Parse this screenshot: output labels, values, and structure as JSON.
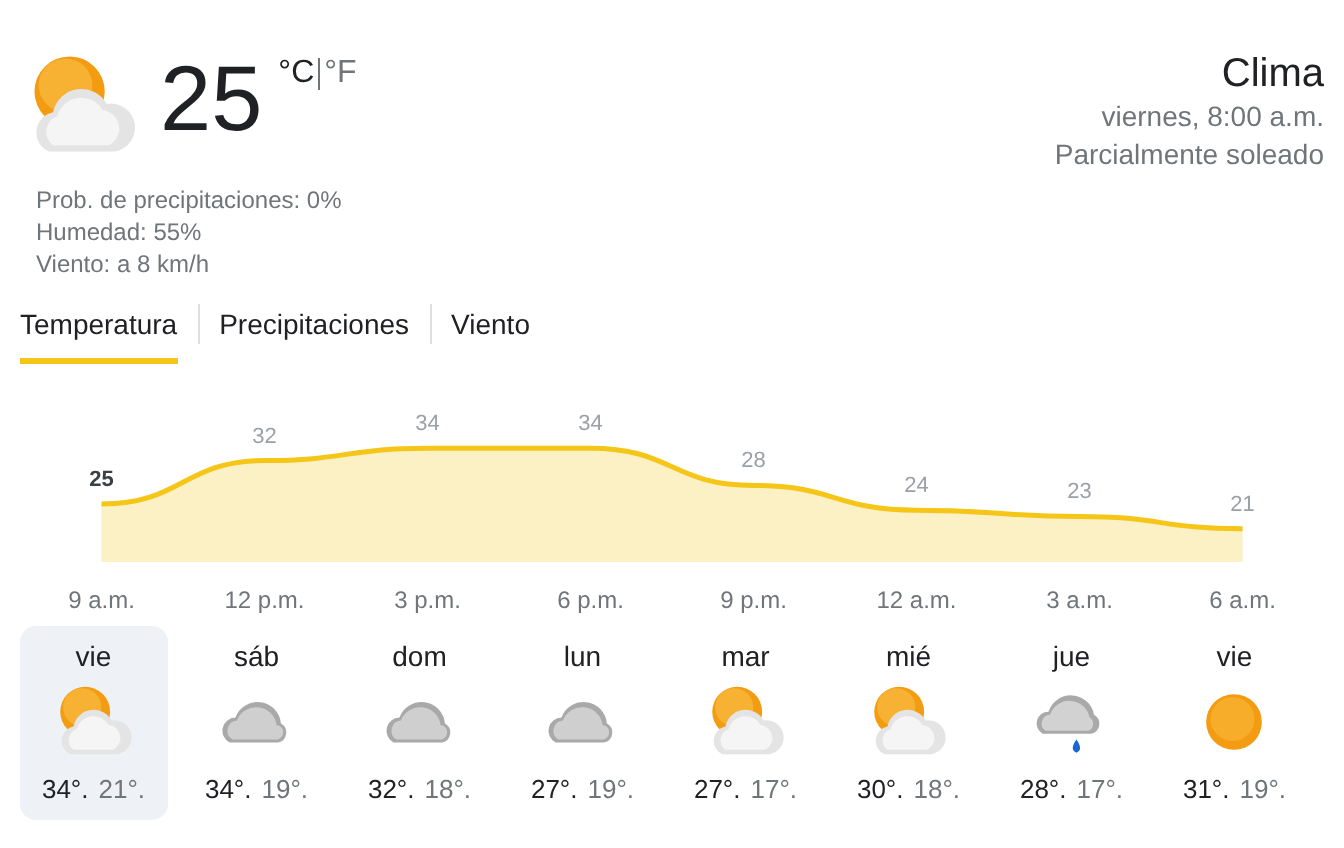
{
  "current": {
    "kind": "partly-cloudy",
    "temperature": "25",
    "units": [
      {
        "label": "°C",
        "selected": true
      },
      {
        "label": "°F",
        "selected": false
      }
    ],
    "details": [
      "Prob. de precipitaciones: 0%",
      "Humedad: 55%",
      "Viento: a 8 km/h"
    ]
  },
  "location": {
    "title": "Clima",
    "time": "viernes, 8:00 a.m.",
    "condition": "Parcialmente soleado"
  },
  "tabs": [
    {
      "label": "Temperatura",
      "selected": true
    },
    {
      "label": "Precipitaciones",
      "selected": false
    },
    {
      "label": "Viento",
      "selected": false
    }
  ],
  "chart_data": {
    "type": "area",
    "categories": [
      "9 a.m.",
      "12 p.m.",
      "3 p.m.",
      "6 p.m.",
      "9 p.m.",
      "12 a.m.",
      "3 a.m.",
      "6 a.m."
    ],
    "data_labels": true,
    "series": [
      {
        "color": "#f5c518",
        "values": [
          25,
          32,
          34,
          34,
          28,
          24,
          23,
          21
        ]
      }
    ]
  },
  "days": [
    {
      "name": "vie",
      "kind": "partly-cloudy",
      "high": "34°.",
      "low": "21°.",
      "selected": true
    },
    {
      "name": "sáb",
      "kind": "cloudy",
      "high": "34°.",
      "low": "19°.",
      "selected": false
    },
    {
      "name": "dom",
      "kind": "cloudy",
      "high": "32°.",
      "low": "18°.",
      "selected": false
    },
    {
      "name": "lun",
      "kind": "cloudy",
      "high": "27°.",
      "low": "19°.",
      "selected": false
    },
    {
      "name": "mar",
      "kind": "partly-cloudy",
      "high": "27°.",
      "low": "17°.",
      "selected": false
    },
    {
      "name": "mié",
      "kind": "partly-cloudy",
      "high": "30°.",
      "low": "18°.",
      "selected": false
    },
    {
      "name": "jue",
      "kind": "rain",
      "high": "28°.",
      "low": "17°.",
      "selected": false
    },
    {
      "name": "vie",
      "kind": "sunny",
      "high": "31°.",
      "low": "19°.",
      "selected": false
    }
  ]
}
